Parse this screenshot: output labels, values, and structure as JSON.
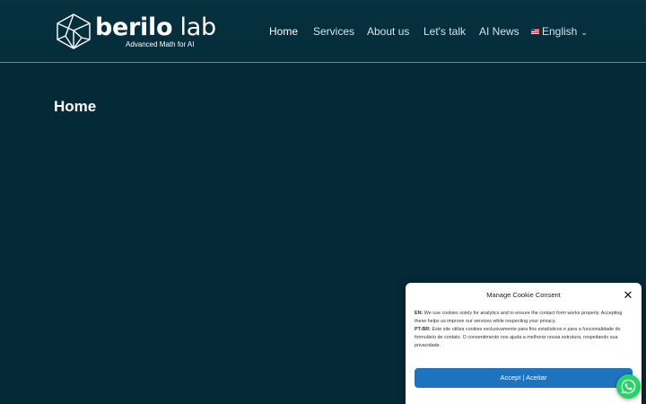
{
  "header": {
    "logo": {
      "name_bold": "berilo",
      "name_light": " lab",
      "tagline": "Advanced Math for AI"
    },
    "nav": [
      {
        "label": "Home",
        "active": true
      },
      {
        "label": "Services",
        "active": false
      },
      {
        "label": "About us",
        "active": false
      },
      {
        "label": "Let's talk",
        "active": false
      },
      {
        "label": "AI News",
        "active": false
      }
    ],
    "language": {
      "label": "English",
      "flag_icon": "us-flag-icon",
      "chevron_icon": "chevron-down-icon"
    }
  },
  "page": {
    "title": "Home"
  },
  "cookie": {
    "title": "Manage Cookie Consent",
    "close_icon": "close-icon",
    "en_label": "EN:",
    "en_text": " We use cookies solely for analytics and to ensure the contact form works properly. Accepting these helps us improve our services while respecting your privacy.",
    "pt_label": "PT-BR:",
    "pt_text": " Este site utiliza cookies exclusivamente para fins estatísticos e para a funcionalidade do formulário de contato. O consentimento nos ajuda a melhorar nossa estrutura, respeitando sua privacidade.",
    "accept_label": "Accept | Aceitar"
  },
  "whatsapp": {
    "icon": "whatsapp-icon"
  },
  "colors": {
    "background": "#042a37",
    "header": "#06313f",
    "accent_button": "#1e73be",
    "whatsapp": "#25d366"
  }
}
